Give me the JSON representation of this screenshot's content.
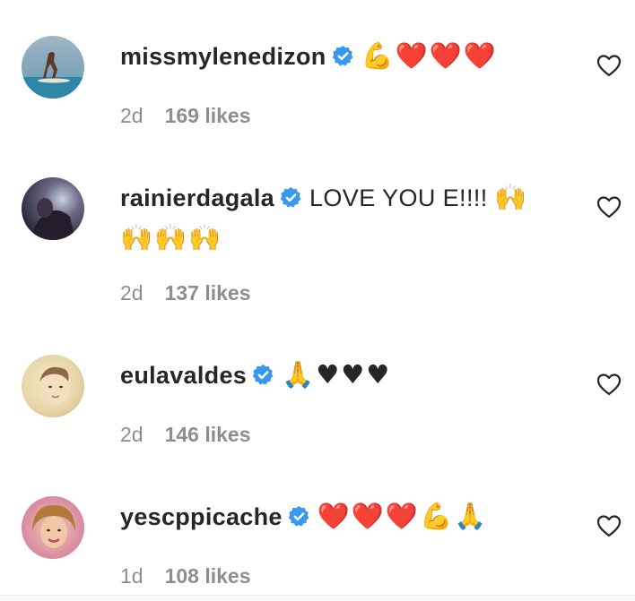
{
  "comments": [
    {
      "username": "missmylenedizon",
      "verified": true,
      "text": "",
      "emojis": "💪❤️❤️❤️",
      "age": "2d",
      "likes": "169 likes",
      "icon": "heart-outline-icon"
    },
    {
      "username": "rainierdagala",
      "verified": true,
      "text": "LOVE YOU E!!!!",
      "emojis": "🙌",
      "emojis_line2": "🙌🙌🙌",
      "age": "2d",
      "likes": "137 likes",
      "icon": "heart-outline-icon"
    },
    {
      "username": "eulavaldes",
      "verified": true,
      "text": "",
      "emojis": "🙏♥♥♥",
      "age": "2d",
      "likes": "146 likes",
      "icon": "heart-outline-icon"
    },
    {
      "username": "yescppicache",
      "verified": true,
      "text": "",
      "emojis": "❤️❤️❤️💪🙏",
      "age": "1d",
      "likes": "108 likes",
      "icon": "heart-outline-icon"
    }
  ],
  "colors": {
    "text": "#262626",
    "meta": "#8e8e8e",
    "verified": "#3897f0"
  }
}
